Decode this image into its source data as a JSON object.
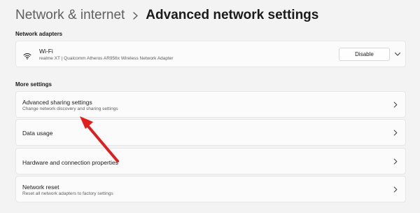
{
  "breadcrumb": {
    "parent": "Network & internet",
    "separator_icon": "chevron-right-icon",
    "current": "Advanced network settings"
  },
  "network_adapters": {
    "label": "Network adapters",
    "adapter": {
      "icon": "wifi-icon",
      "name": "Wi-Fi",
      "description": "realme XT | Qualcomm Atheros AR956x Wireless Network Adapter",
      "disable_label": "Disable",
      "expand_icon": "chevron-down-icon"
    }
  },
  "more_settings": {
    "label": "More settings",
    "items": [
      {
        "title": "Advanced sharing settings",
        "subtitle": "Change network discovery and sharing settings",
        "icon": "chevron-right-icon"
      },
      {
        "title": "Data usage",
        "icon": "chevron-right-icon"
      },
      {
        "title": "Hardware and connection properties",
        "icon": "chevron-right-icon"
      },
      {
        "title": "Network reset",
        "subtitle": "Reset all network adapters to factory settings",
        "icon": "chevron-right-icon"
      }
    ]
  },
  "annotation": {
    "type": "red-arrow",
    "color": "#e11d1d",
    "points_to": "Advanced sharing settings"
  },
  "colors": {
    "background": "#f3f3f3",
    "card": "#fbfbfb",
    "text": "#1b1b1b",
    "secondary_text": "#5f5f5f"
  }
}
